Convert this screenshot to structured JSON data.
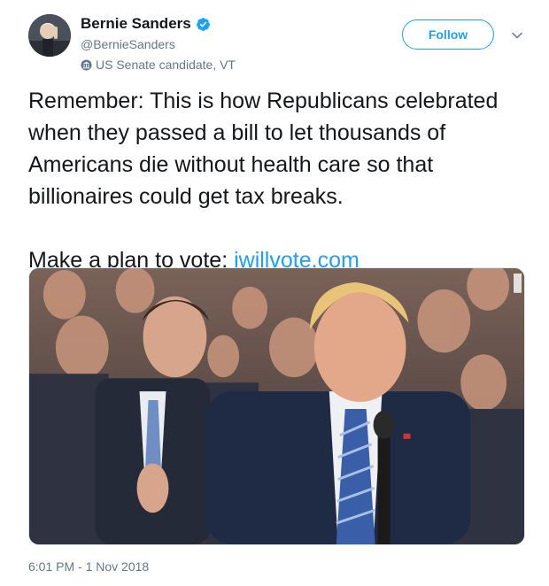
{
  "tweet": {
    "author": {
      "display_name": "Bernie Sanders",
      "handle": "@BernieSanders",
      "label": "US Senate candidate, VT",
      "verified": true
    },
    "follow_label": "Follow",
    "text_lines": [
      "Remember: This is how Republicans celebrated when they passed a bill to let thousands of Americans die without health care so that billionaires could get tax breaks."
    ],
    "cta_text": "Make a plan to vote: ",
    "link_text": "iwillvote.com",
    "timestamp": "6:01 PM - 1 Nov 2018"
  },
  "icons": {
    "verified": "verified-badge-icon",
    "government": "government-building-icon",
    "caret": "chevron-down-icon"
  },
  "colors": {
    "accent": "#1da1f2",
    "text": "#14171a",
    "secondary_text": "#657786",
    "border": "#e1e8ed"
  }
}
